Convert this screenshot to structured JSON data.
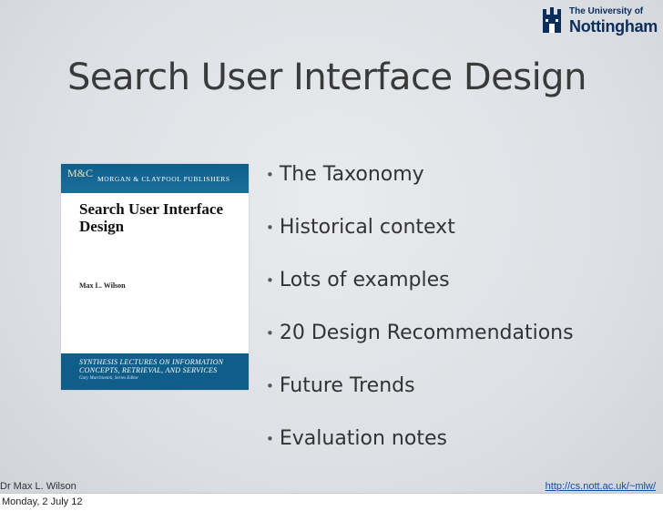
{
  "logo": {
    "line1": "The University of",
    "line2": "Nottingham"
  },
  "slide": {
    "title": "Search User Interface Design",
    "bullets": [
      "The Taxonomy",
      "Historical context",
      "Lots of examples",
      "20 Design Recommendations",
      "Future Trends",
      "Evaluation notes"
    ]
  },
  "book": {
    "publisher_mark": "M&C",
    "publisher": "MORGAN & CLAYPOOL PUBLISHERS",
    "title": "Search User Interface Design",
    "author": "Max L. Wilson",
    "series": "SYNTHESIS LECTURES ON INFORMATION CONCEPTS, RETRIEVAL, AND SERVICES",
    "editor": "Gary Marchionini, Series Editor"
  },
  "footer": {
    "author": "Dr Max L. Wilson",
    "url": "http://cs.nott.ac.uk/~mlw/",
    "date": "Monday, 2 July 12"
  },
  "colors": {
    "book_blue": "#0f5e8a",
    "logo_navy": "#0b2d5c",
    "link_blue": "#1a4aa6"
  }
}
